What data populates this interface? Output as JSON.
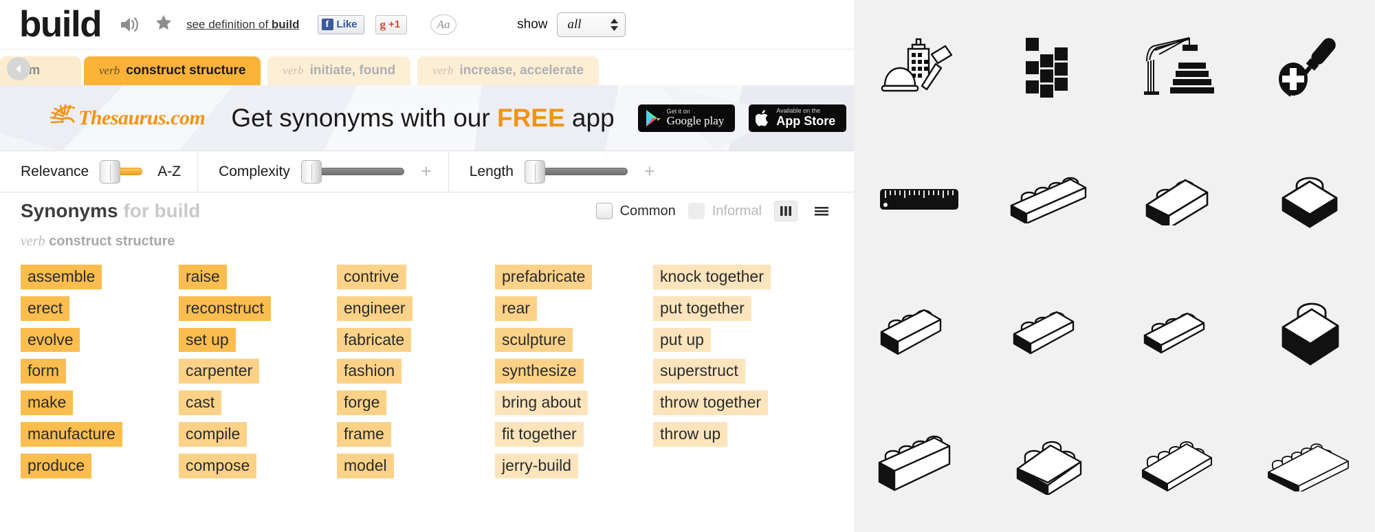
{
  "header": {
    "word": "build",
    "speaker_icon": "speaker-icon",
    "star_icon": "star-icon",
    "see_definition_prefix": "see definition of ",
    "see_definition_word": "build",
    "facebook_like": "Like",
    "facebook_glyph": "f",
    "google_plus": "+1",
    "google_glyph": "g",
    "font_size_icon": "Aa",
    "show_label": "show",
    "show_value": "all",
    "show_options": [
      "all"
    ]
  },
  "tabs": [
    {
      "pos": "",
      "label": "rm",
      "state": "partial"
    },
    {
      "pos": "verb",
      "label": "construct structure",
      "state": "active"
    },
    {
      "pos": "verb",
      "label": "initiate, found",
      "state": "inactive"
    },
    {
      "pos": "verb",
      "label": "increase, accelerate",
      "state": "inactive"
    }
  ],
  "banner": {
    "brand": "Thesaurus.com",
    "text_before": "Get synonyms with our ",
    "text_free": "FREE",
    "text_after": " app",
    "google_badge": {
      "top": "Get it on",
      "bottom": "Google play"
    },
    "apple_badge": {
      "top": "Available on the",
      "bottom": "App Store"
    }
  },
  "sliders": [
    {
      "name": "Relevance",
      "end_label": "A-Z",
      "fill": "orange",
      "has_plus": false
    },
    {
      "name": "Complexity",
      "end_label": "",
      "fill": "grey",
      "has_plus": true
    },
    {
      "name": "Length",
      "end_label": "",
      "fill": "grey",
      "has_plus": true
    }
  ],
  "synonyms_header": {
    "title": "Synonyms",
    "for_text": "for build",
    "common_label": "Common",
    "informal_label": "Informal",
    "column_view_icon": "columns-view-icon",
    "list_view_icon": "list-view-icon"
  },
  "sense": {
    "pos": "verb",
    "label": "construct structure"
  },
  "columns": [
    {
      "words": [
        {
          "text": "assemble",
          "relevance": 3
        },
        {
          "text": "erect",
          "relevance": 3
        },
        {
          "text": "evolve",
          "relevance": 3
        },
        {
          "text": "form",
          "relevance": 3
        },
        {
          "text": "make",
          "relevance": 3
        },
        {
          "text": "manufacture",
          "relevance": 3
        },
        {
          "text": "produce",
          "relevance": 3
        }
      ]
    },
    {
      "words": [
        {
          "text": "raise",
          "relevance": 3
        },
        {
          "text": "reconstruct",
          "relevance": 3
        },
        {
          "text": "set up",
          "relevance": 3
        },
        {
          "text": "carpenter",
          "relevance": 2
        },
        {
          "text": "cast",
          "relevance": 2
        },
        {
          "text": "compile",
          "relevance": 2
        },
        {
          "text": "compose",
          "relevance": 2
        }
      ]
    },
    {
      "words": [
        {
          "text": "contrive",
          "relevance": 2
        },
        {
          "text": "engineer",
          "relevance": 2
        },
        {
          "text": "fabricate",
          "relevance": 2
        },
        {
          "text": "fashion",
          "relevance": 2
        },
        {
          "text": "forge",
          "relevance": 2
        },
        {
          "text": "frame",
          "relevance": 2
        },
        {
          "text": "model",
          "relevance": 2
        }
      ]
    },
    {
      "words": [
        {
          "text": "prefabricate",
          "relevance": 2
        },
        {
          "text": "rear",
          "relevance": 2
        },
        {
          "text": "sculpture",
          "relevance": 2
        },
        {
          "text": "synthesize",
          "relevance": 2
        },
        {
          "text": "bring about",
          "relevance": 1
        },
        {
          "text": "fit together",
          "relevance": 1
        },
        {
          "text": "jerry-build",
          "relevance": 1
        }
      ]
    },
    {
      "words": [
        {
          "text": "knock together",
          "relevance": 1
        },
        {
          "text": "put together",
          "relevance": 1
        },
        {
          "text": "put up",
          "relevance": 1
        },
        {
          "text": "superstruct",
          "relevance": 1
        },
        {
          "text": "throw together",
          "relevance": 1
        },
        {
          "text": "throw up",
          "relevance": 1
        }
      ]
    }
  ],
  "image_panel": {
    "background": "#f1f1f1",
    "items": [
      {
        "icon": "hardhat-building-hammer-icon"
      },
      {
        "icon": "blocks-pattern-icon"
      },
      {
        "icon": "crane-icon"
      },
      {
        "icon": "screwdriver-screw-icon"
      },
      {
        "icon": "ruler-icon"
      },
      {
        "icon": "lego-brick-1x4-icon"
      },
      {
        "icon": "lego-brick-1x2-icon"
      },
      {
        "icon": "lego-brick-1x1-icon"
      },
      {
        "icon": "lego-brick-1x3-tall-icon"
      },
      {
        "icon": "lego-brick-1x3-icon"
      },
      {
        "icon": "lego-brick-1x3-flat-icon"
      },
      {
        "icon": "lego-brick-tall-1x1-icon"
      },
      {
        "icon": "lego-brick-1x4-tall-icon"
      },
      {
        "icon": "lego-brick-2x2-icon"
      },
      {
        "icon": "lego-plate-2x4-icon"
      },
      {
        "icon": "lego-plate-2x6-icon"
      }
    ]
  },
  "colors": {
    "accent_orange": "#f9b339",
    "chip_high": "#fbbd4e",
    "chip_mid": "#fbd288",
    "chip_low": "#fce4bd",
    "brand_orange": "#f39314"
  }
}
